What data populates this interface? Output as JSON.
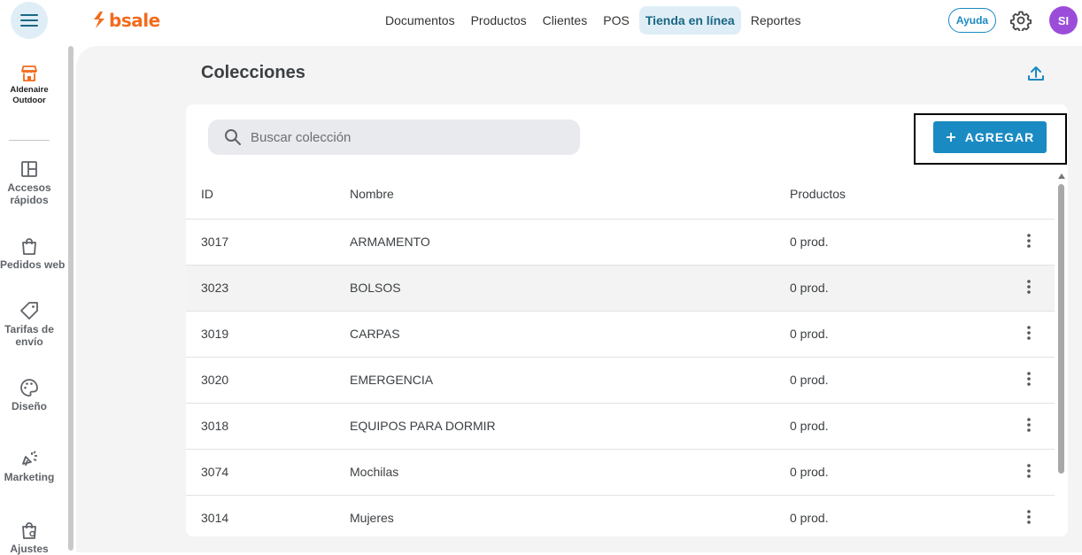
{
  "header": {
    "logo_text": "bsale",
    "nav": [
      {
        "label": "Documentos",
        "active": false
      },
      {
        "label": "Productos",
        "active": false
      },
      {
        "label": "Clientes",
        "active": false
      },
      {
        "label": "POS",
        "active": false
      },
      {
        "label": "Tienda en línea",
        "active": true
      },
      {
        "label": "Reportes",
        "active": false
      }
    ],
    "help_label": "Ayuda",
    "avatar_initials": "SI"
  },
  "sidebar": {
    "store_name": "Aldenaire Outdoor",
    "items": [
      {
        "label": "Accesos rápidos",
        "icon": "layout-icon"
      },
      {
        "label": "Pedidos web",
        "icon": "shopping-bag-icon"
      },
      {
        "label": "Tarifas de envío",
        "icon": "tag-icon"
      },
      {
        "label": "Diseño",
        "icon": "palette-icon"
      },
      {
        "label": "Marketing",
        "icon": "megaphone-icon"
      },
      {
        "label": "Ajustes",
        "icon": "settings-bag-icon"
      }
    ]
  },
  "main": {
    "title": "Colecciones",
    "search_placeholder": "Buscar colección",
    "add_button": "AGREGAR",
    "table": {
      "columns": [
        "ID",
        "Nombre",
        "Productos"
      ],
      "rows": [
        {
          "id": "3017",
          "name": "ARMAMENTO",
          "products": "0 prod."
        },
        {
          "id": "3023",
          "name": "BOLSOS",
          "products": "0 prod."
        },
        {
          "id": "3019",
          "name": "CARPAS",
          "products": "0 prod."
        },
        {
          "id": "3020",
          "name": "EMERGENCIA",
          "products": "0 prod."
        },
        {
          "id": "3018",
          "name": "EQUIPOS PARA DORMIR",
          "products": "0 prod."
        },
        {
          "id": "3074",
          "name": "Mochilas",
          "products": "0 prod."
        },
        {
          "id": "3014",
          "name": "Mujeres",
          "products": "0 prod."
        }
      ]
    }
  },
  "colors": {
    "brand_orange": "#f26b1d",
    "accent_blue": "#1a8ac2",
    "avatar_purple": "#9b4dda"
  }
}
